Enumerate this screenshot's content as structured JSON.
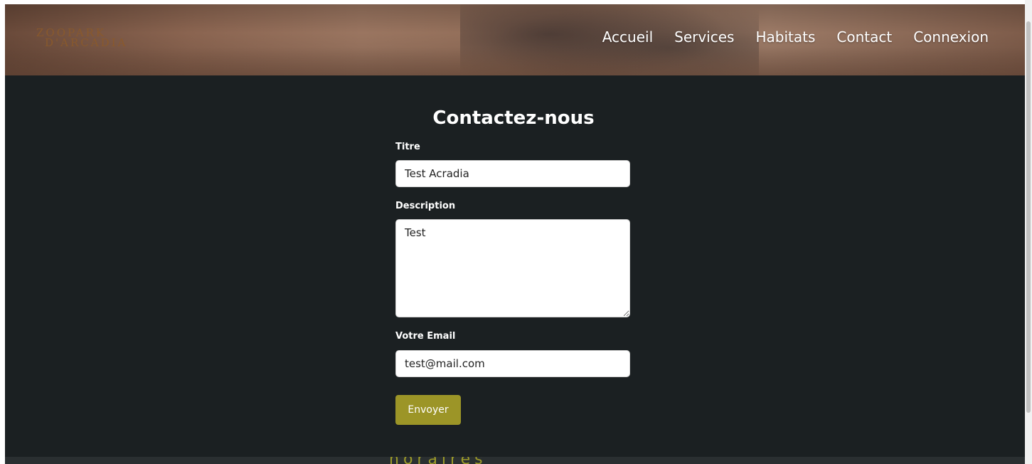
{
  "header": {
    "logo_line1": "ZOOPARK",
    "logo_line2": "D'ARCADIA",
    "nav": [
      {
        "label": "Accueil"
      },
      {
        "label": "Services"
      },
      {
        "label": "Habitats"
      },
      {
        "label": "Contact"
      },
      {
        "label": "Connexion"
      }
    ]
  },
  "form": {
    "title": "Contactez-nous",
    "title_label": "Titre",
    "title_value": "Test Acradia",
    "description_label": "Description",
    "description_value": "Test",
    "email_label": "Votre Email",
    "email_value": "test@mail.com",
    "submit_label": "Envoyer"
  },
  "footer": {
    "heading_partial": "horaires d'ouverture"
  },
  "colors": {
    "background": "#1b2022",
    "accent": "#9c9527",
    "text": "#ffffff"
  }
}
